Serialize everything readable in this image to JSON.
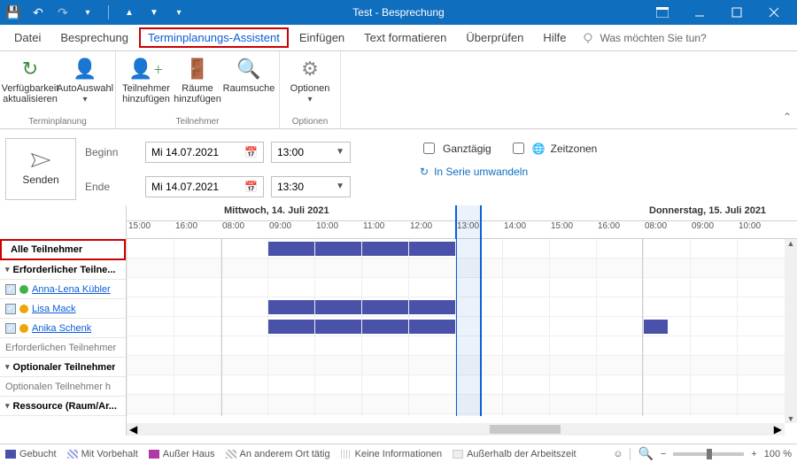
{
  "window": {
    "title": "Test  -  Besprechung"
  },
  "tabs": {
    "items": [
      "Datei",
      "Besprechung",
      "Terminplanungs-Assistent",
      "Einfügen",
      "Text formatieren",
      "Überprüfen",
      "Hilfe"
    ],
    "active_index": 2,
    "tell_me": "Was möchten Sie tun?"
  },
  "ribbon": {
    "group1": {
      "label": "Terminplanung",
      "refresh": "Verfügbarkeit aktualisieren",
      "auto": "AutoAuswahl"
    },
    "group2": {
      "label": "Teilnehmer",
      "add_att": "Teilnehmer hinzufügen",
      "add_room": "Räume hinzufügen",
      "find_room": "Raumsuche"
    },
    "group3": {
      "label": "Optionen",
      "options": "Optionen"
    }
  },
  "fields": {
    "send": "Senden",
    "begin_lbl": "Beginn",
    "end_lbl": "Ende",
    "begin_date": "Mi 14.07.2021",
    "begin_time": "13:00",
    "end_date": "Mi 14.07.2021",
    "end_time": "13:30",
    "allday": "Ganztägig",
    "timezones": "Zeitzonen",
    "recur": "In Serie umwandeln"
  },
  "schedule": {
    "all": "Alle Teilnehmer",
    "day1": "Mittwoch, 14. Juli 2021",
    "day2": "Donnerstag, 15. Juli 2021",
    "hours": [
      "15:00",
      "16:00",
      "08:00",
      "09:00",
      "10:00",
      "11:00",
      "12:00",
      "13:00",
      "14:00",
      "15:00",
      "16:00",
      "08:00",
      "09:00",
      "10:00"
    ],
    "req_group": "Erforderlicher Teilne...",
    "opt_group": "Optionaler Teilnehmer",
    "res_group": "Ressource (Raum/Ar...",
    "req_add": "Erforderlichen Teilnehmer",
    "opt_add": "Optionalen Teilnehmer h",
    "attendees": [
      {
        "name": "Anna-Lena Kübler",
        "dot": "#3bb44a"
      },
      {
        "name": "Lisa Mack",
        "dot": "#f0a30a"
      },
      {
        "name": "Anika Schenk",
        "dot": "#f0a30a"
      }
    ]
  },
  "legend": {
    "busy": "Gebucht",
    "tentative": "Mit Vorbehalt",
    "oof": "Außer Haus",
    "elsewhere": "An anderem Ort tätig",
    "noinfo": "Keine Informationen",
    "outside": "Außerhalb der Arbeitszeit"
  },
  "zoom": "100 %"
}
